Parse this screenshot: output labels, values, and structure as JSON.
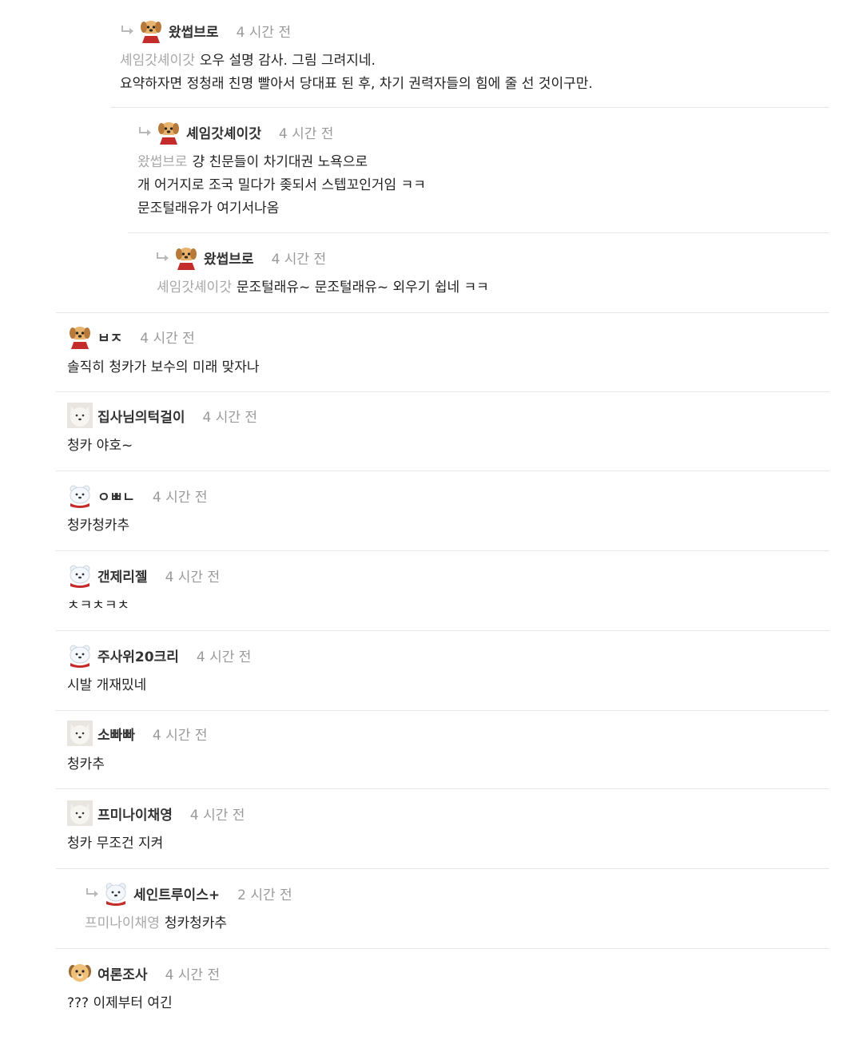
{
  "comments": [
    {
      "nick": "왔썹브로",
      "time": "4 시간 전",
      "mention": "셰임갓셰이갓",
      "lines": [
        "오우 설명 감사. 그림 그려지네.",
        "요약하자면 정청래 친명 빨아서 당대표 된 후, 차기 권력자들의 힘에 줄 선 것이구만."
      ],
      "avatar": "dog-santa"
    },
    {
      "nick": "셰임갓셰이갓",
      "time": "4 시간 전",
      "mention": "왔썹브로",
      "lines": [
        "걍 친문들이 차기대권 노욕으로",
        "개 어거지로 조국 밀다가 좆되서 스텝꼬인거임 ㅋㅋ",
        "문조털래유가 여기서나옴"
      ],
      "avatar": "dog-santa"
    },
    {
      "nick": "왔썹브로",
      "time": "4 시간 전",
      "mention": "셰임갓셰이갓",
      "lines": [
        "문조털래유~ 문조털래유~ 외우기 쉽네 ㅋㅋ"
      ],
      "avatar": "dog-santa"
    },
    {
      "nick": "ㅂㅈ",
      "time": "4 시간 전",
      "mention": "",
      "lines": [
        "솔직히 청카가 보수의 미래 맞자나"
      ],
      "avatar": "dog-santa"
    },
    {
      "nick": "집사님의턱걸이",
      "time": "4 시간 전",
      "mention": "",
      "lines": [
        "청카 야호~"
      ],
      "avatar": "white-dog"
    },
    {
      "nick": "ㅇㅃㄴ",
      "time": "4 시간 전",
      "mention": "",
      "lines": [
        "청카청카추"
      ],
      "avatar": "polar-bear"
    },
    {
      "nick": "갠제리젤",
      "time": "4 시간 전",
      "mention": "",
      "lines": [
        "ㅊㅋㅊㅋㅊ"
      ],
      "avatar": "polar-bear"
    },
    {
      "nick": "주사위20크리",
      "time": "4 시간 전",
      "mention": "",
      "lines": [
        "시발 개재밌네"
      ],
      "avatar": "polar-bear"
    },
    {
      "nick": "소빠빠",
      "time": "4 시간 전",
      "mention": "",
      "lines": [
        "청카추"
      ],
      "avatar": "white-dog"
    },
    {
      "nick": "프미나이채영",
      "time": "4 시간 전",
      "mention": "",
      "lines": [
        "청카 무조건 지켜"
      ],
      "avatar": "white-dog"
    },
    {
      "nick": "세인트루이스+",
      "time": "2 시간 전",
      "mention": "프미나이채영",
      "lines": [
        "청카청카추"
      ],
      "avatar": "polar-bear"
    },
    {
      "nick": "여론조사",
      "time": "4 시간 전",
      "mention": "",
      "lines": [
        "??? 이제부터 여긴"
      ],
      "avatar": "puppy-face"
    }
  ],
  "colors": {
    "divider": "#e6e6e6",
    "mention": "#a8a8a8",
    "time": "#9a9a9a",
    "reply_arrow": "#b9b9b9"
  },
  "icons": [
    "reply-arrow-icon"
  ]
}
